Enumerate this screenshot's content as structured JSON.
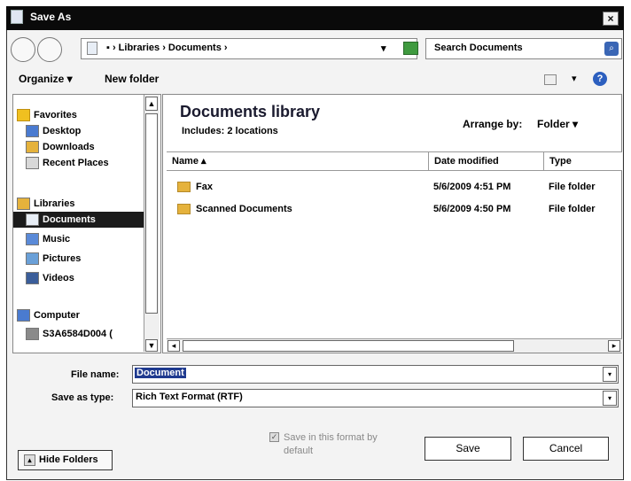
{
  "window": {
    "title": "Save As",
    "close_glyph": "×"
  },
  "address": {
    "path": "▪ › Libraries › Documents ›",
    "dropdown_glyph": "▾",
    "search_placeholder": "Search Documents",
    "search_icon_glyph": "⌕"
  },
  "toolbar": {
    "organize": "Organize ▾",
    "new_folder": "New folder",
    "views_dropdown": "▾",
    "help": "?"
  },
  "nav": {
    "favorites": "Favorites",
    "desktop": "Desktop",
    "downloads": "Downloads",
    "recent_places": "Recent Places",
    "libraries": "Libraries",
    "documents": "Documents",
    "music": "Music",
    "pictures": "Pictures",
    "videos": "Videos",
    "computer": "Computer",
    "drive": "S3A6584D004 (",
    "scroll_up": "▲",
    "scroll_down": "▼"
  },
  "library": {
    "title": "Documents library",
    "subtitle": "Includes: 2 locations",
    "arrange_label": "Arrange by:",
    "arrange_value": "Folder ▾"
  },
  "columns": {
    "name": "Name ▴",
    "date": "Date modified",
    "type": "Type"
  },
  "files": [
    {
      "name": "Fax",
      "date": "5/6/2009 4:51 PM",
      "type": "File folder"
    },
    {
      "name": "Scanned Documents",
      "date": "5/6/2009 4:50 PM",
      "type": "File folder"
    }
  ],
  "hscroll": {
    "left": "◂",
    "right": "▸"
  },
  "form": {
    "file_name_label": "File name:",
    "file_name_value": "Document",
    "save_type_label": "Save as type:",
    "save_type_value": "Rich Text Format (RTF)",
    "dropdown_glyph": "▾"
  },
  "bottom": {
    "save_format_line1": "Save in this format by",
    "save_format_line2": "default",
    "check_glyph": "✓",
    "save": "Save",
    "cancel": "Cancel",
    "hide_folders": "Hide Folders",
    "hide_glyph": "▴"
  }
}
